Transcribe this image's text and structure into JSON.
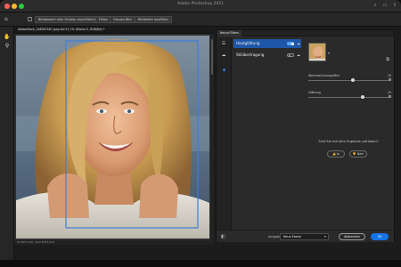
{
  "app": {
    "title": "Adobe Photoshop 2021"
  },
  "options_bar": {
    "select_all_layers_label": "Bildbereich aller Fenster durchführen",
    "buttons": [
      "Füllen",
      "Ganzes Bild",
      "Bildbreite ausfüllen"
    ]
  },
  "document": {
    "tab_label": "AdobeStock_148097467.jpeg bei 51,7% (Ebene 0, RGB/8#) *",
    "status_text": "51,69%    Dok: 19,0 M/37,9 M"
  },
  "dialog": {
    "title": "Neural Filters",
    "filters": [
      {
        "label": "Hautglättung",
        "enabled": true
      },
      {
        "label": "Stilübertragung",
        "enabled": false
      }
    ],
    "sliders": [
      {
        "label": "Weichzeichnungsfilter",
        "value": "15",
        "fraction": 0.56
      },
      {
        "label": "Glättung",
        "value": "25",
        "fraction": 0.68
      }
    ],
    "feedback_question": "Sind Sie mit dem Ergebnis zufrieden?",
    "feedback_yes": "Ja",
    "feedback_no": "Nein",
    "output_label": "Ausgabe",
    "output_value": "Neue Ebene",
    "cancel_label": "Abbrechen",
    "ok_label": "OK"
  },
  "colors": {
    "accent": "#1473e6",
    "selected_filter": "#1f57a8",
    "toggle_on": "#58a6ff"
  },
  "icons": {
    "tools": [
      "hand-icon",
      "zoom-icon"
    ],
    "rail": [
      "filter-list-icon",
      "cloud-icon",
      "active-dot"
    ],
    "footer": [
      "compare-layers-icon"
    ]
  }
}
